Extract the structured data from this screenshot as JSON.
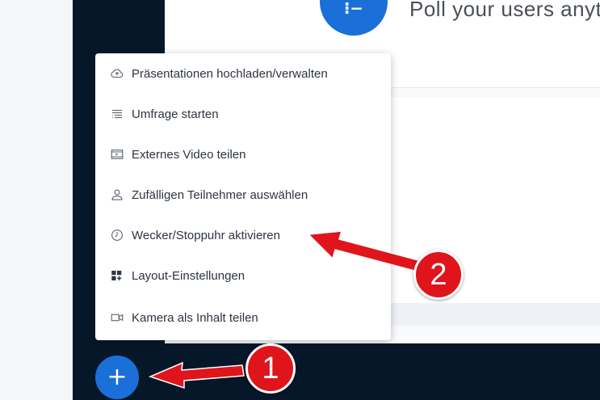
{
  "content": {
    "poll_icon_glyph": "⁝−",
    "poll_text": "Poll your users anytim"
  },
  "menu": {
    "items": [
      {
        "label": "Präsentationen hochladen/verwalten",
        "icon": "cloud-upload-icon"
      },
      {
        "label": "Umfrage starten",
        "icon": "poll-list-icon"
      },
      {
        "label": "Externes Video teilen",
        "icon": "external-video-icon"
      },
      {
        "label": "Zufälligen Teilnehmer auswählen",
        "icon": "user-icon"
      },
      {
        "label": "Wecker/Stoppuhr aktivieren",
        "icon": "clock-icon"
      },
      {
        "label": "Layout-Einstellungen",
        "icon": "layout-icon"
      },
      {
        "label": "Kamera als Inhalt teilen",
        "icon": "camera-icon"
      }
    ]
  },
  "actions_button": {
    "glyph": "+"
  },
  "annotations": {
    "badge_1": "1",
    "badge_2": "2"
  },
  "colors": {
    "accent": "#1b6fd8",
    "dark_panel": "#06172a",
    "annotation_red": "#e0141b"
  }
}
